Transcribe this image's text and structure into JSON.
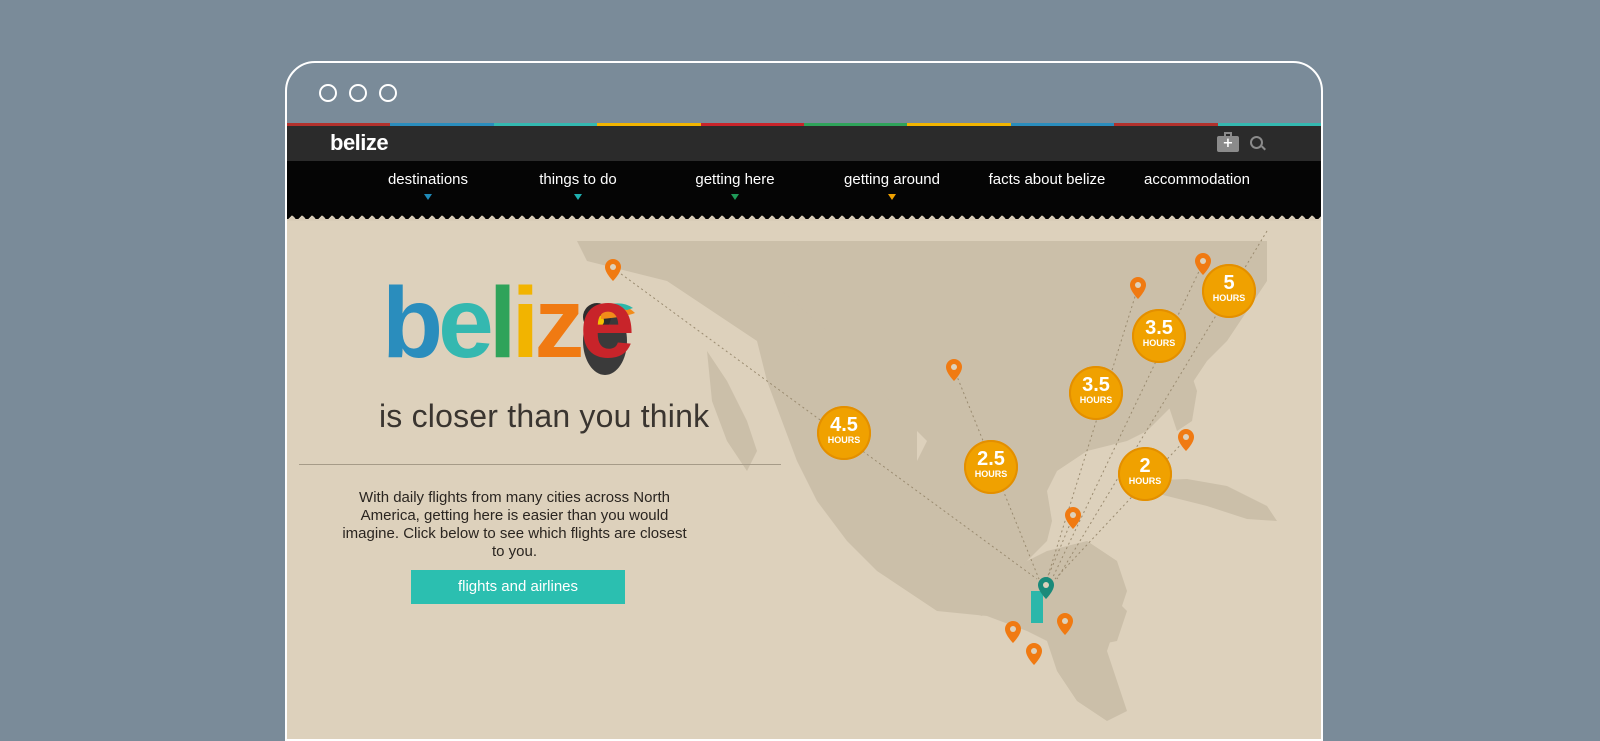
{
  "browser": {
    "dots": [
      "close",
      "minimize",
      "maximize"
    ]
  },
  "header": {
    "logo": "belize",
    "icons": [
      "briefcase-icon",
      "search-icon"
    ]
  },
  "nav": {
    "items": [
      {
        "label": "destinations",
        "color": "#1f8ab8"
      },
      {
        "label": "things to do",
        "color": "#1fb0b0"
      },
      {
        "label": "getting here",
        "color": "#1f9a58"
      },
      {
        "label": "getting around",
        "color": "#f0a100"
      },
      {
        "label": "facts about belize",
        "color": ""
      },
      {
        "label": "accommodation",
        "color": ""
      }
    ]
  },
  "hero": {
    "logo_letters": [
      {
        "char": "b",
        "color": "#2a8dbd"
      },
      {
        "char": "e",
        "color": "#34b8b0"
      },
      {
        "char": "l",
        "color": "#2fa35a"
      },
      {
        "char": "i",
        "color": "#f2b400"
      },
      {
        "char": "z",
        "color": "#f07a12"
      },
      {
        "char": "e",
        "color": "#c8242a"
      }
    ],
    "tagline": "is closer than you think",
    "body": "With daily flights from many cities across North America, getting here is easier than you would imagine. Click below to see which flights are closest to you.",
    "button": "flights and airlines"
  },
  "badges": [
    {
      "value": "4.5",
      "unit": "HOURS"
    },
    {
      "value": "2.5",
      "unit": "HOURS"
    },
    {
      "value": "3.5",
      "unit": "HOURS"
    },
    {
      "value": "3.5",
      "unit": "HOURS"
    },
    {
      "value": "5",
      "unit": "HOURS"
    },
    {
      "value": "2",
      "unit": "HOURS"
    }
  ],
  "colors": {
    "accent_teal": "#2bbfb0",
    "pin_orange": "#f07a12",
    "badge_orange": "#f0a100",
    "belize_marker": "#1a8a7a"
  }
}
